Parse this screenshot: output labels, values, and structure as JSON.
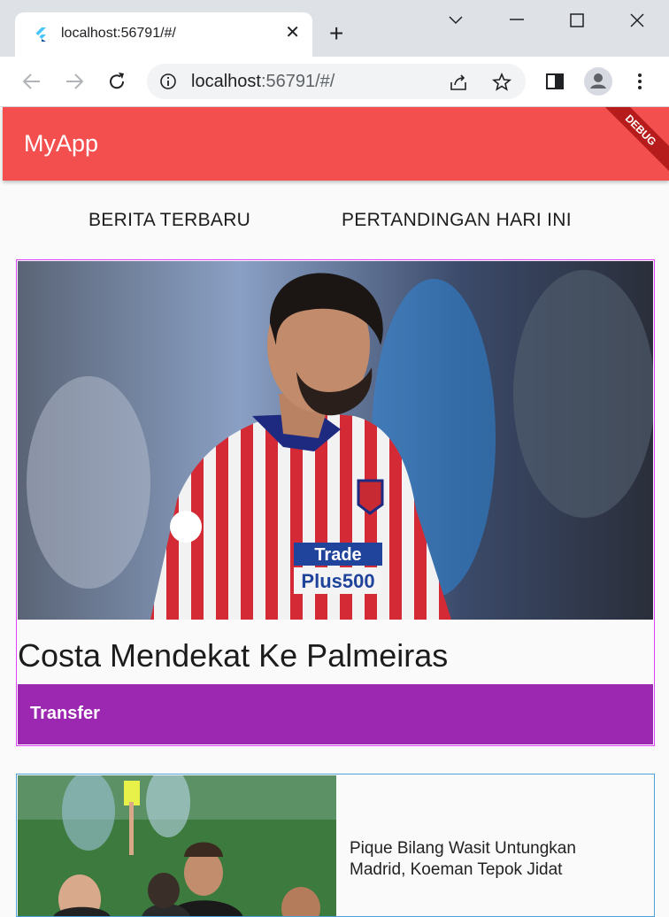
{
  "browser": {
    "tab_title": "localhost:56791/#/",
    "url_host": "localhost",
    "url_rest": ":56791/#/"
  },
  "app": {
    "title": "MyApp",
    "debug_label": "DEBUG",
    "tabs": [
      {
        "label": "BERITA TERBARU"
      },
      {
        "label": "PERTANDINGAN HARI INI"
      }
    ],
    "articles": [
      {
        "title": "Costa Mendekat Ke Palmeiras",
        "category": "Transfer"
      },
      {
        "title": "Pique Bilang Wasit Untungkan Madrid, Koeman Tepok Jidat"
      }
    ]
  },
  "colors": {
    "appbar": "#f44f4f",
    "category_band": "#9c27b0",
    "card1_border": "#e040fb",
    "card2_border": "#4ea2dc"
  }
}
